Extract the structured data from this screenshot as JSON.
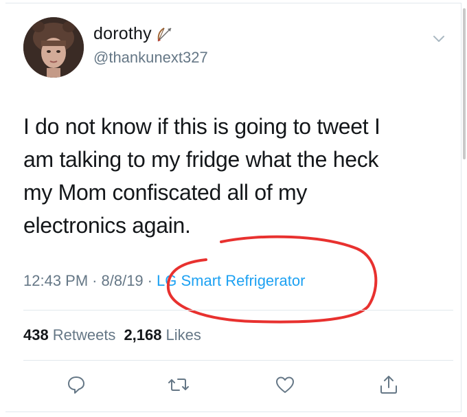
{
  "user": {
    "display_name": "dorothy",
    "name_emoji_icon": "bow-and-arrow-icon",
    "handle": "@thankunext327"
  },
  "tweet": {
    "text": "I do not know if this is going to tweet I\nam talking to my fridge what the heck\nmy Mom confiscated all of my\nelectronics again.",
    "time": "12:43 PM",
    "separator": "·",
    "date": "8/8/19",
    "source": "LG Smart Refrigerator"
  },
  "stats": {
    "retweets_count": "438",
    "retweets_label": "Retweets",
    "likes_count": "2,168",
    "likes_label": "Likes"
  },
  "actions": {
    "reply_icon": "reply-bubble-icon",
    "retweet_icon": "retweet-icon",
    "like_icon": "heart-icon",
    "share_icon": "share-icon"
  },
  "colors": {
    "link": "#1da1f2",
    "secondary_text": "#657786",
    "annotation": "#e8312f",
    "divider": "#e1e8ed"
  }
}
